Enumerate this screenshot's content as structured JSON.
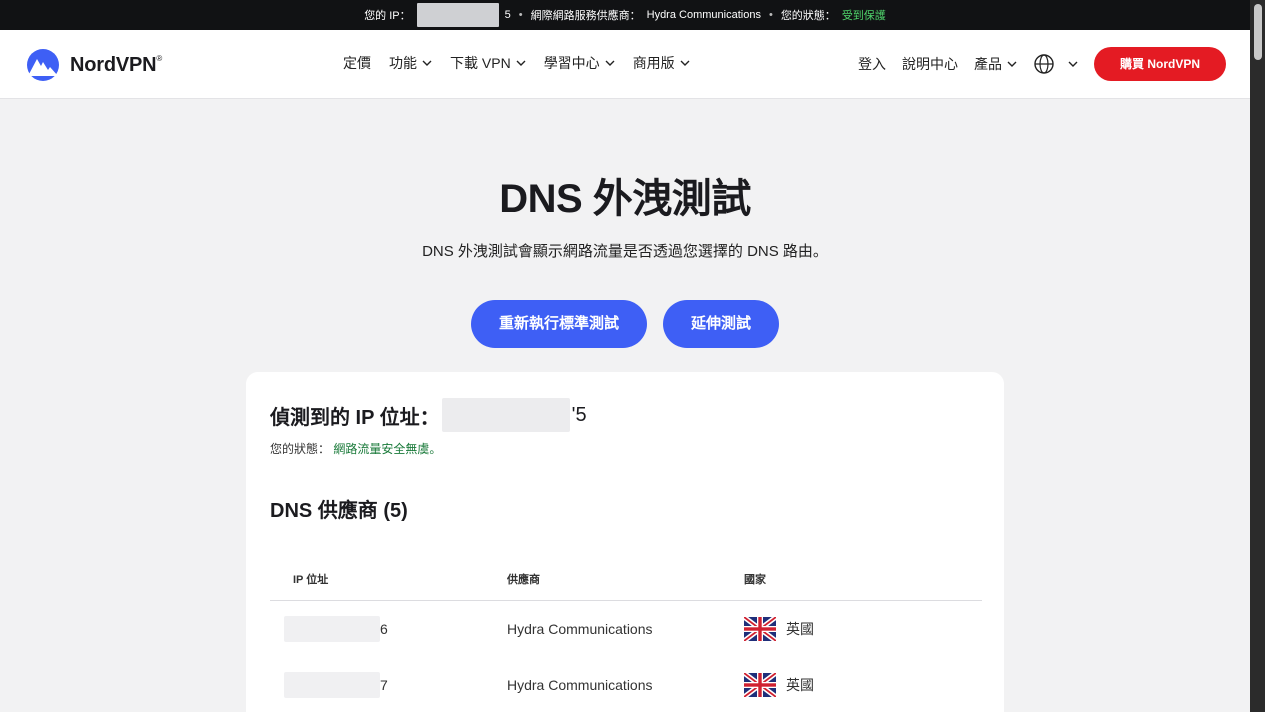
{
  "topbar": {
    "ip_label": "您的 IP：",
    "ip_suffix": "5",
    "sep": "•",
    "isp_label": "網際網路服務供應商：",
    "isp_value": "Hydra Communications",
    "status_label": "您的狀態：",
    "status_value": "受到保護"
  },
  "nav": {
    "brand": "NordVPN",
    "trademark": "®",
    "items": [
      "定價",
      "功能",
      "下載 VPN",
      "學習中心",
      "商用版"
    ],
    "right": {
      "login": "登入",
      "help": "說明中心",
      "products": "產品"
    },
    "buy_label": "購買 NordVPN"
  },
  "hero": {
    "title": "DNS 外洩測試",
    "subtitle": "DNS 外洩測試會顯示網路流量是否透過您選擇的 DNS 路由。",
    "rerun_label": "重新執行標準測試",
    "extended_label": "延伸測試"
  },
  "result": {
    "ip_label": "偵測到的 IP 位址：",
    "ip_suffix": "'5",
    "status_label": "您的狀態：",
    "status_value": "網路流量安全無虞。",
    "dns_title": "DNS 供應商 (5)",
    "columns": [
      "IP 位址",
      "供應商",
      "國家"
    ],
    "rows": [
      {
        "ip_suffix": "6",
        "provider": "Hydra Communications",
        "country": "英國"
      },
      {
        "ip_suffix": "7",
        "provider": "Hydra Communications",
        "country": "英國"
      }
    ]
  },
  "colors": {
    "accent_blue": "#3e5ff5",
    "buy_red": "#e41b23",
    "protected_green": "#4fd36b"
  }
}
